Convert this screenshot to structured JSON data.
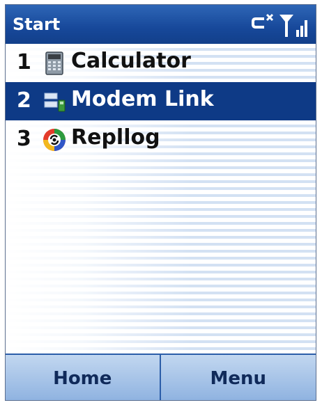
{
  "header": {
    "title": "Start",
    "status_icons": [
      "no-connection-icon",
      "signal-strength-icon"
    ]
  },
  "menu": {
    "selected_index": 1,
    "items": [
      {
        "number": "1",
        "label": "Calculator",
        "icon": "calculator-icon"
      },
      {
        "number": "2",
        "label": "Modem Link",
        "icon": "modem-link-icon"
      },
      {
        "number": "3",
        "label": "Repllog",
        "icon": "repllog-icon"
      }
    ]
  },
  "softkeys": {
    "left": "Home",
    "right": "Menu"
  },
  "colors": {
    "title_bar": "#17489a",
    "selection": "#0e3a86",
    "softkey_bar": "#a9c4e8"
  }
}
